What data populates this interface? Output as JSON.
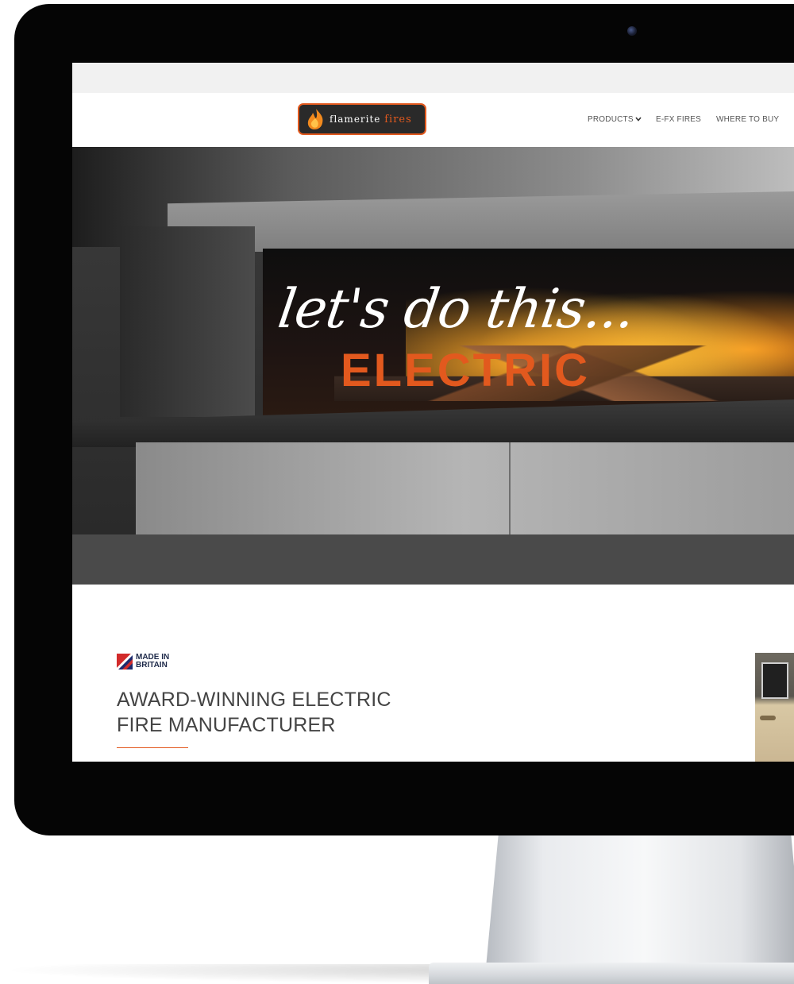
{
  "site": {
    "logo": {
      "name": "flamerite",
      "suffix": "fires"
    },
    "nav": [
      {
        "label": "PRODUCTS",
        "has_dropdown": true
      },
      {
        "label": "E-FX FIRES",
        "has_dropdown": false
      },
      {
        "label": "WHERE TO BUY",
        "has_dropdown": false
      }
    ],
    "hero": {
      "script_text": "let's do this...",
      "headline": "ELECTRIC"
    },
    "badge": {
      "line1": "MADE IN",
      "line2": "BRITAIN"
    },
    "section": {
      "headline_line1": "AWARD-WINNING ELECTRIC",
      "headline_line2": "FIRE MANUFACTURER"
    }
  },
  "colors": {
    "accent": "#e2591e",
    "nav_text": "#555555",
    "headline_text": "#444444"
  },
  "icons": {
    "dropdown": "chevron-down-icon",
    "flame": "flame-icon",
    "flag": "union-flag-icon"
  }
}
